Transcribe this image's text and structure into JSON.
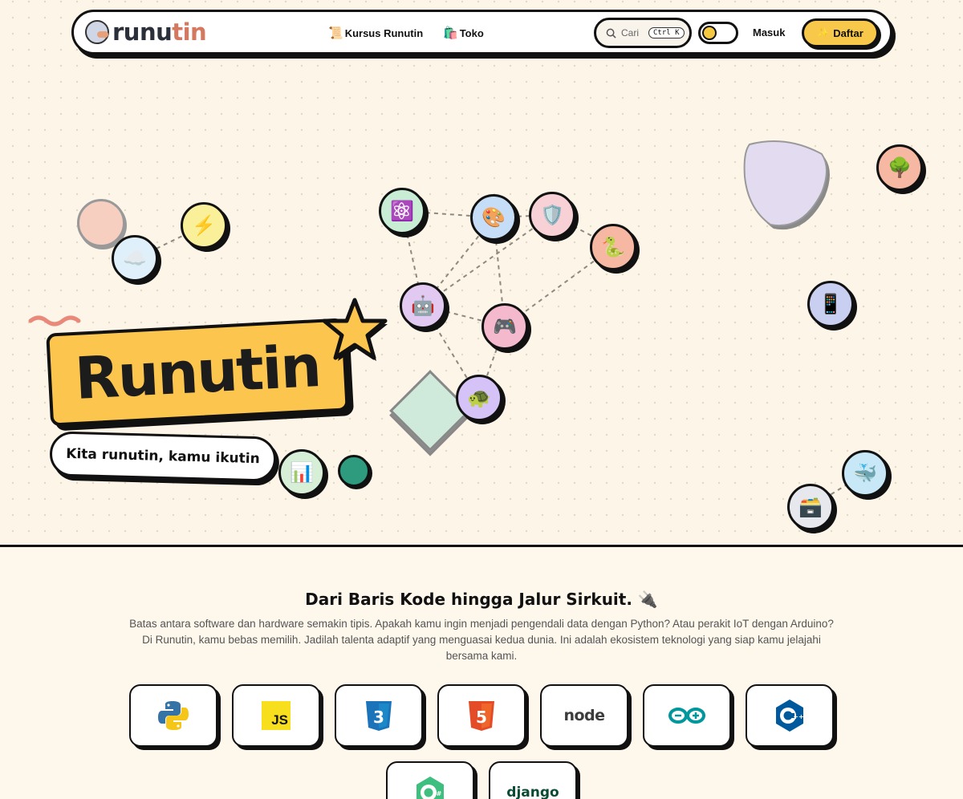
{
  "nav": {
    "brand_a": "runu",
    "brand_b": "tin",
    "links": [
      {
        "label": "Kursus Runutin",
        "icon": "📜"
      },
      {
        "label": "Toko",
        "icon": "🛍️"
      }
    ],
    "search_label": "Cari",
    "search_shortcut": "Ctrl K",
    "login": "Masuk",
    "register": "Daftar",
    "register_icon": "✨"
  },
  "hero": {
    "title": "Runutin",
    "tagline": "Kita runutin, kamu ikutin",
    "bubbles": [
      {
        "name": "lightning",
        "icon": "⚡",
        "color": "#fbf09a"
      },
      {
        "name": "cloud",
        "icon": "☁️",
        "color": "#dff0fb"
      },
      {
        "name": "atom",
        "icon": "⚛️",
        "color": "#c9ecd4"
      },
      {
        "name": "palette",
        "icon": "🎨",
        "color": "#c6ddf7"
      },
      {
        "name": "shield",
        "icon": "🛡️",
        "color": "#f7d1d6"
      },
      {
        "name": "snake",
        "icon": "🐍",
        "color": "#f6b7a3"
      },
      {
        "name": "robot",
        "icon": "🤖",
        "color": "#e2c9f1"
      },
      {
        "name": "gamepad",
        "icon": "🎮",
        "color": "#f5b9cd"
      },
      {
        "name": "turtle",
        "icon": "🐢",
        "color": "#d5c2f7"
      },
      {
        "name": "chart",
        "icon": "📊",
        "color": "#d6efd6"
      },
      {
        "name": "tree",
        "icon": "🌳",
        "color": "#f6b7a3"
      },
      {
        "name": "phone",
        "icon": "📱",
        "color": "#c9cff0"
      },
      {
        "name": "whale",
        "icon": "🐳",
        "color": "#c8e8f8"
      },
      {
        "name": "chest",
        "icon": "🗃️",
        "color": "#e6e8ee"
      }
    ]
  },
  "section": {
    "title": "Dari Baris Kode hingga Jalur Sirkuit. 🔌",
    "description": "Batas antara software dan hardware semakin tipis. Apakah kamu ingin menjadi pengendali data dengan Python? Atau perakit IoT dengan Arduino? Di Runutin, kamu bebas memilih. Jadilah talenta adaptif yang menguasai kedua dunia. Ini adalah ekosistem teknologi yang siap kamu jelajahi bersama kami.",
    "techs": [
      {
        "name": "python",
        "label": ""
      },
      {
        "name": "javascript",
        "label": "JS"
      },
      {
        "name": "css3",
        "label": "3"
      },
      {
        "name": "html5",
        "label": "5"
      },
      {
        "name": "nodejs",
        "label": "node"
      },
      {
        "name": "arduino",
        "label": ""
      },
      {
        "name": "cplusplus",
        "label": "C++"
      },
      {
        "name": "csharp",
        "label": "C#"
      },
      {
        "name": "django",
        "label": "django"
      }
    ]
  }
}
